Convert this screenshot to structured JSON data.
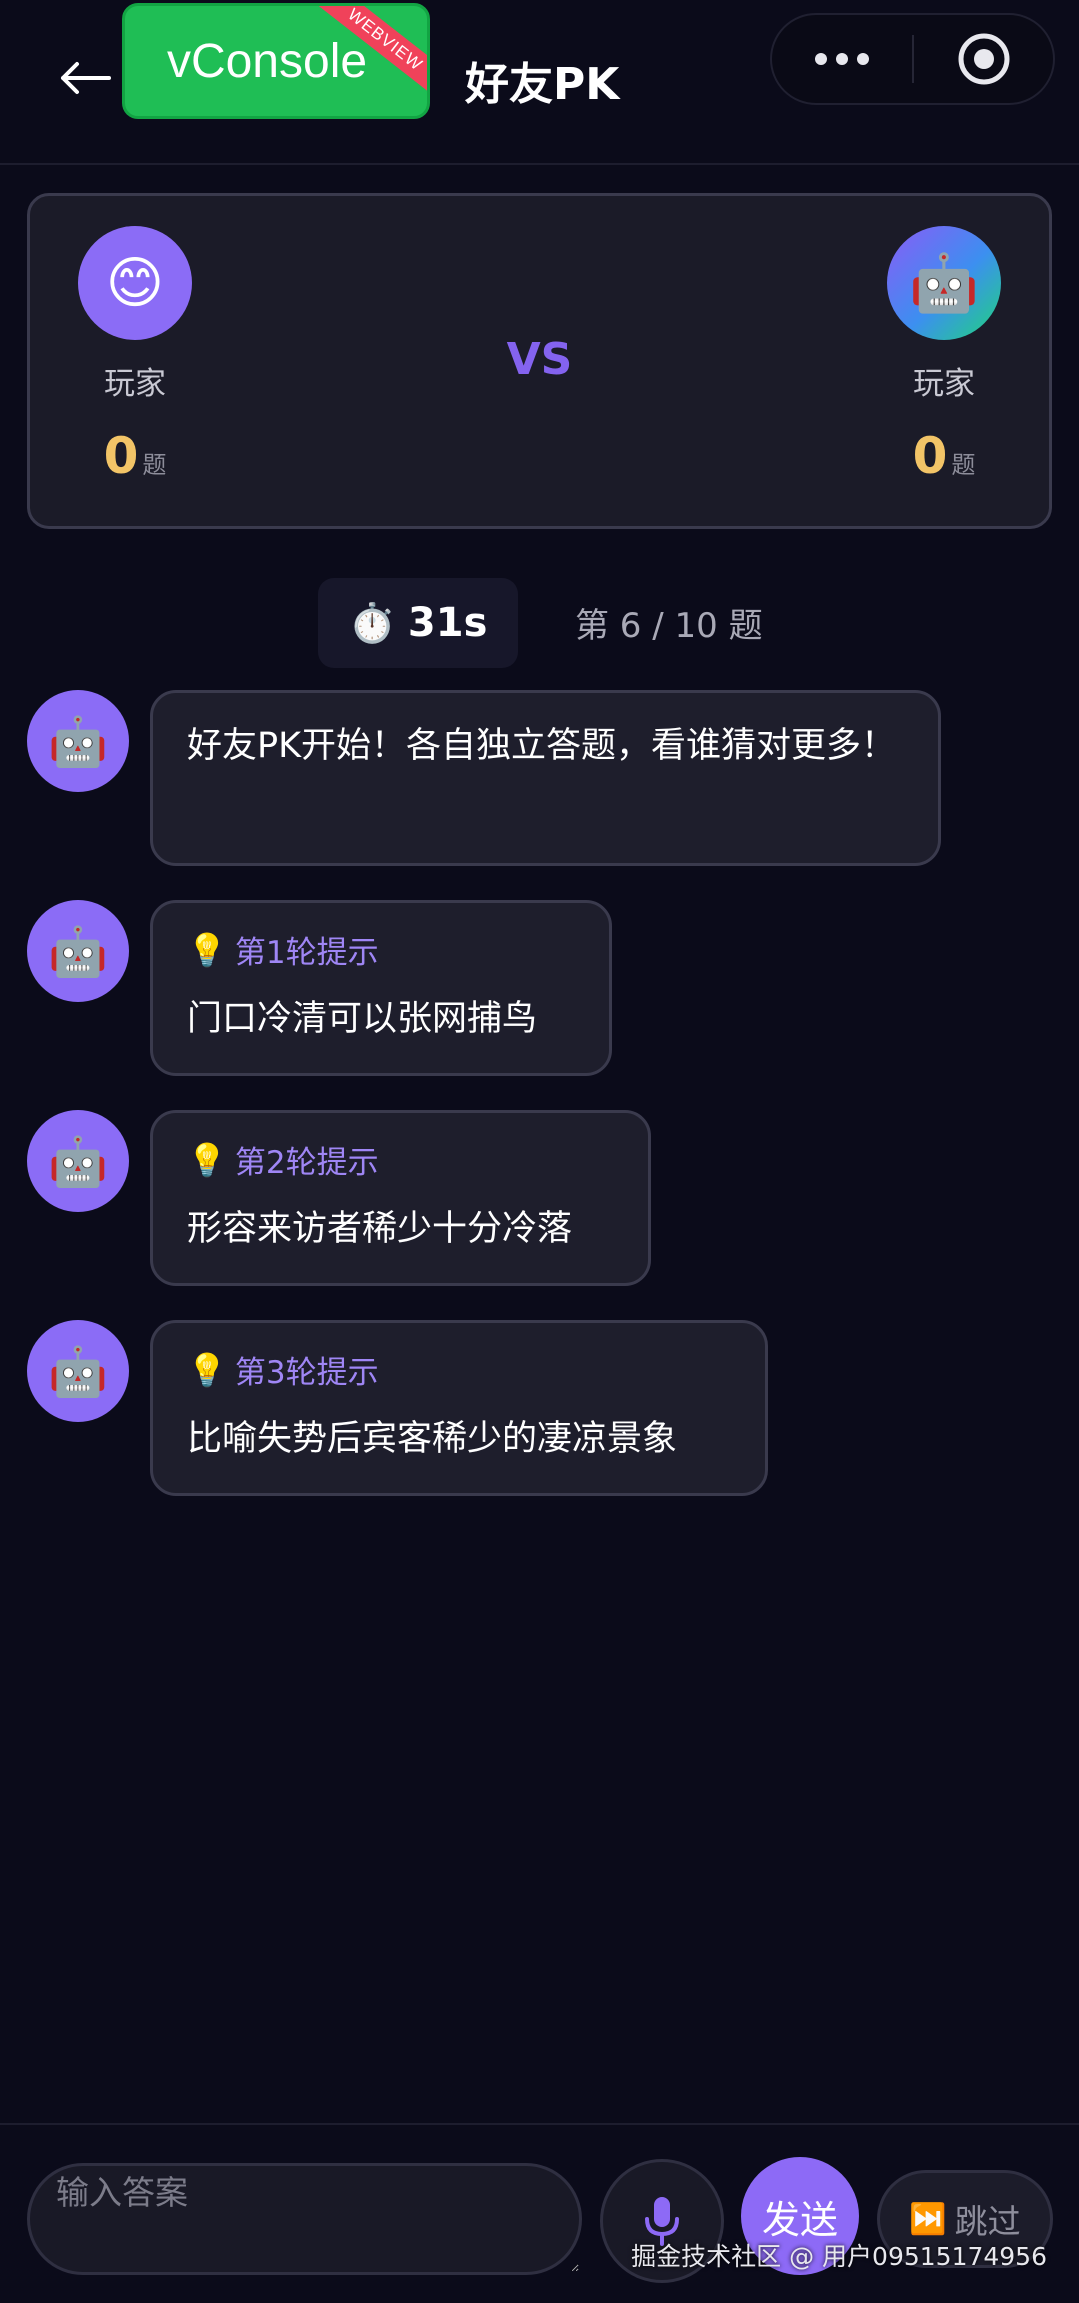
{
  "header": {
    "back_icon": "arrow-left-icon",
    "vconsole_label": "vConsole",
    "vconsole_badge": "WEBVIEW",
    "title": "好友PK",
    "more_icon": "more-dots-icon",
    "close_icon": "target-circle-icon"
  },
  "scoreboard": {
    "left": {
      "avatar": "😊",
      "name": "玩家",
      "score": "0",
      "unit": "题"
    },
    "vs": "VS",
    "right": {
      "avatar": "🤖",
      "name": "玩家",
      "score": "0",
      "unit": "题"
    }
  },
  "timer": {
    "icon": "⏱️",
    "value": "31s"
  },
  "progress": "第 6 / 10 题",
  "messages": [
    {
      "avatar": "🤖",
      "text": "好友PK开始！各自独立答题，看谁猜对更多！"
    },
    {
      "avatar": "🤖",
      "hint_icon": "💡",
      "hint_title": "第1轮提示",
      "text": "门口冷清可以张网捕鸟"
    },
    {
      "avatar": "🤖",
      "hint_icon": "💡",
      "hint_title": "第2轮提示",
      "text": "形容来访者稀少十分冷落"
    },
    {
      "avatar": "🤖",
      "hint_icon": "💡",
      "hint_title": "第3轮提示",
      "text": "比喻失势后宾客稀少的凄凉景象"
    }
  ],
  "input": {
    "placeholder": "输入答案",
    "value": ""
  },
  "actions": {
    "mic_icon": "microphone-icon",
    "send_label": "发送",
    "skip_icon": "⏭️",
    "skip_label": "跳过"
  },
  "watermark": "掘金技术社区 @ 用户09515174956",
  "colors": {
    "background": "#0b0b1a",
    "accent": "#8d6af6",
    "score": "#f2c467",
    "vconsole": "#1fbe55"
  }
}
